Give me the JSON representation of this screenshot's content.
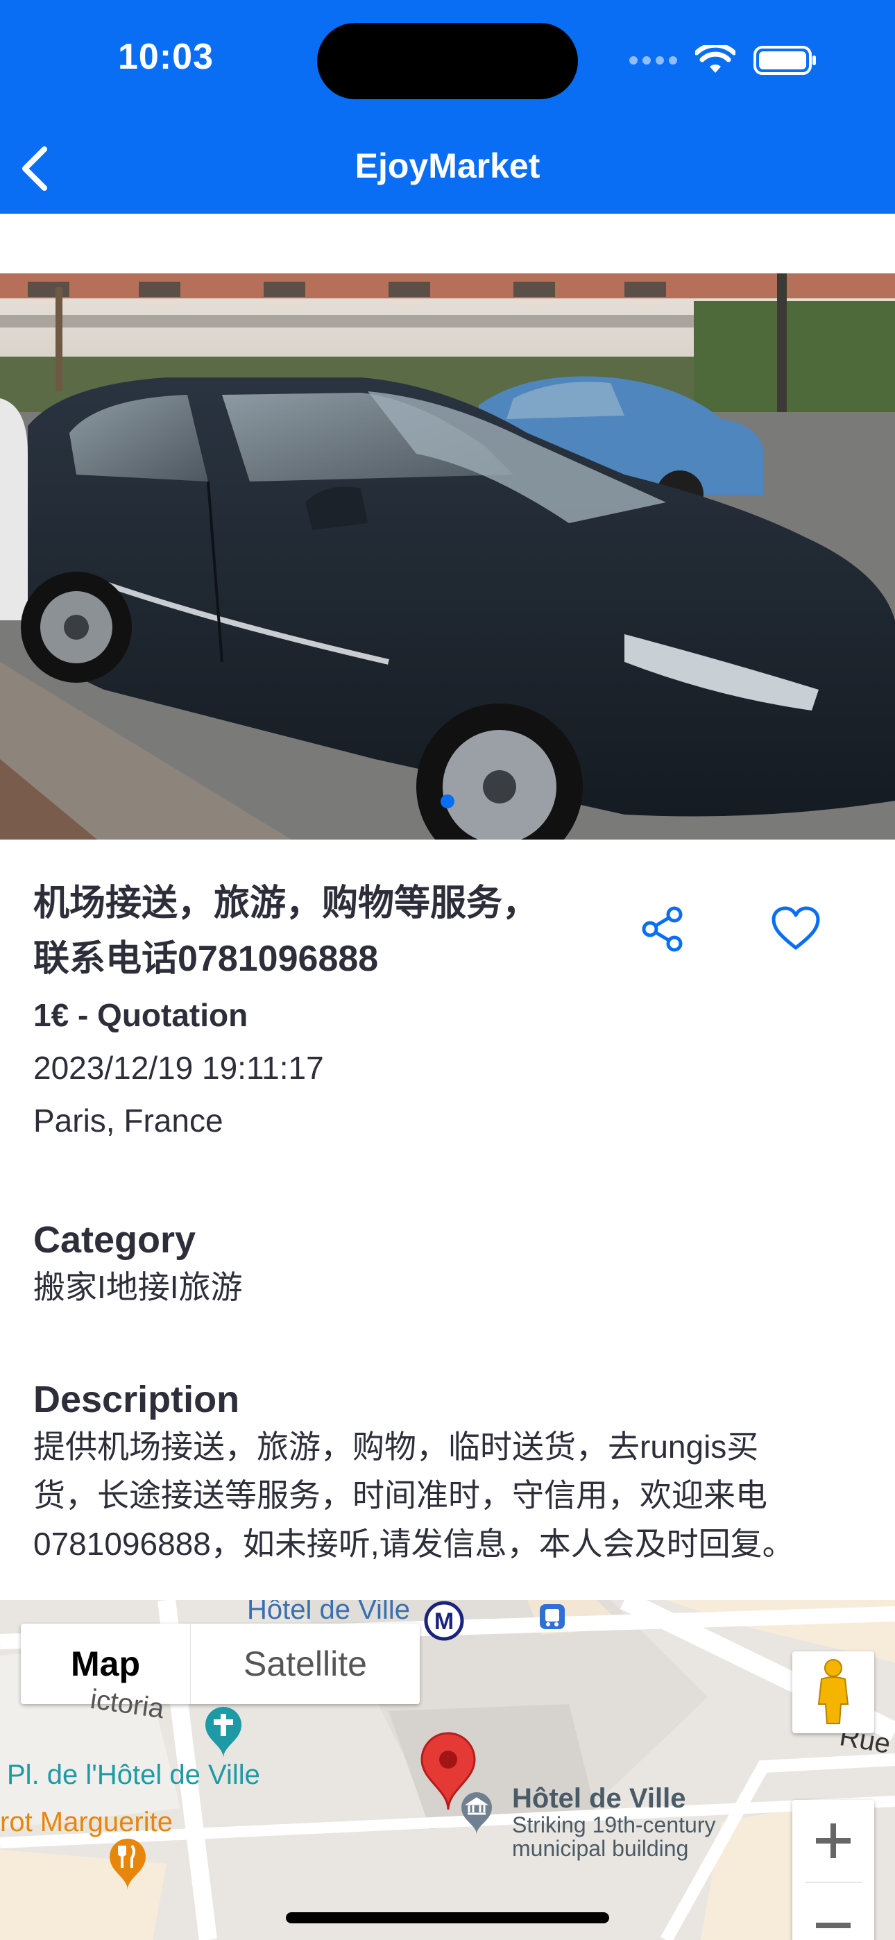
{
  "status_bar": {
    "time": "10:03"
  },
  "nav": {
    "title": "EjoyMarket"
  },
  "listing": {
    "title_line1": "机场接送，旅游，购物等服务，",
    "title_line2": "联系电话0781096888",
    "price": "1€ - Quotation",
    "date": "2023/12/19 19:11:17",
    "location": "Paris, France"
  },
  "category": {
    "heading": "Category",
    "value": "搬家I地接I旅游"
  },
  "description": {
    "heading": "Description",
    "line1": "提供机场接送，旅游，购物，临时送货，去rungis买",
    "line2": "货，长途接送等服务，时间准时，守信用，欢迎来电",
    "line3": "0781096888，如未接听,请发信息，本人会及时回复。"
  },
  "map": {
    "toggle_map": "Map",
    "toggle_satellite": "Satellite",
    "label_top": "Hôtel de Ville",
    "label_victoria": "ictoria",
    "label_place": "Pl. de l'Hôtel de Ville",
    "label_marguerite": "rot Marguerite",
    "label_rue": "Rue",
    "poi_name": "Hôtel de Ville",
    "poi_desc1": "Striking 19th-century",
    "poi_desc2": "municipal building",
    "metro_letter": "M",
    "zoom_in": "+",
    "zoom_out": "−"
  },
  "icons": [
    "back-icon",
    "wifi-icon",
    "battery-icon",
    "share-icon",
    "heart-icon",
    "map-pin-icon",
    "pegman-icon",
    "metro-icon",
    "bus-icon",
    "restaurant-icon",
    "museum-icon"
  ],
  "colors": {
    "brand": "#0a6ef5",
    "text": "#2e2e3a",
    "pin": "#e53935",
    "poi_teal": "#1e9aa6",
    "poi_orange": "#e8860c"
  }
}
